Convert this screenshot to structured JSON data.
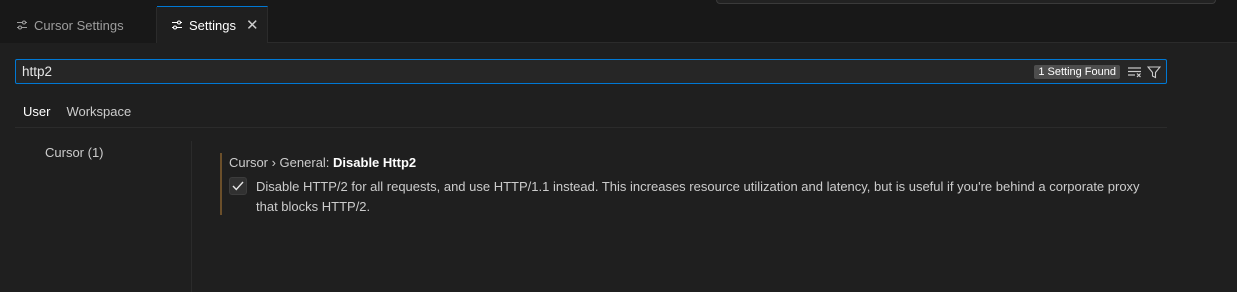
{
  "tabs": [
    {
      "label": "Cursor Settings",
      "icon": "settings-sliders-icon",
      "active": false
    },
    {
      "label": "Settings",
      "icon": "settings-sliders-icon",
      "active": true,
      "close": "✕"
    }
  ],
  "search": {
    "value": "http2",
    "results_badge": "1 Setting Found",
    "icons": [
      "clear-filter-icon",
      "filter-icon"
    ]
  },
  "scopes": [
    "User",
    "Workspace"
  ],
  "toc": {
    "items": [
      "Cursor (1)"
    ]
  },
  "setting": {
    "category": "Cursor › General: ",
    "name": "Disable Http2",
    "checked": true,
    "description": "Disable HTTP/2 for all requests, and use HTTP/1.1 instead. This increases resource utilization and latency, but is useful if you're behind a corporate proxy that blocks HTTP/2."
  },
  "colors": {
    "accent": "#0078d4",
    "modified_bar": "#6b4f2a",
    "background": "#1f1f1f"
  }
}
